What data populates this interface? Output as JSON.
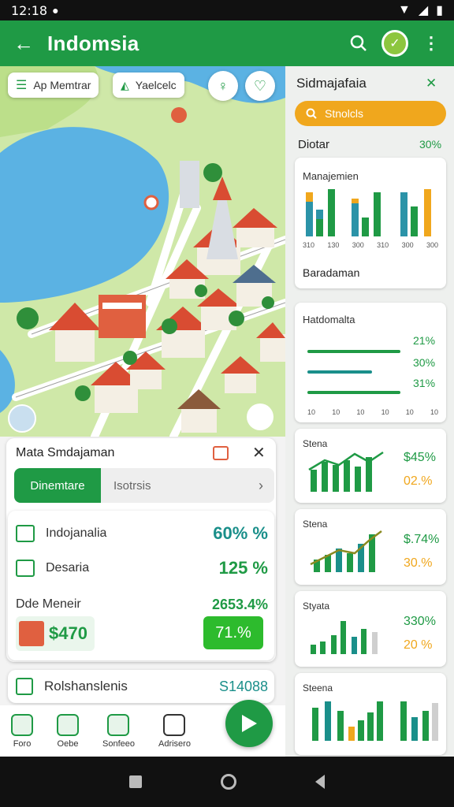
{
  "status": {
    "time": "12:18"
  },
  "appbar": {
    "title": "Indomsia",
    "back_icon": "arrow-back-icon",
    "search_icon": "search-icon",
    "avatar_icon": "profile-avatar",
    "more_icon": "more-vert-icon"
  },
  "map": {
    "chip_layers": "Ap Memtrar",
    "chip_vehicle": "Yaelcelc",
    "locate_icon": "location-icon"
  },
  "detail": {
    "title": "Mata Smdajaman",
    "tab_active": "Dinemtare",
    "tab_inactive": "Isotrsis",
    "rows": [
      {
        "label": "Indojanalia",
        "value": "60% %"
      },
      {
        "label": "Desaria",
        "value": "125 %"
      },
      {
        "label": "Dde Meneir",
        "value": "2653.4%"
      }
    ],
    "price": "$470",
    "badge": "71.%",
    "summary_label": "Rolshanslenis",
    "summary_value": "S14088"
  },
  "bottom_nav": [
    {
      "label": "Foro",
      "icon": "home-icon"
    },
    {
      "label": "Oebe",
      "icon": "bulb-icon"
    },
    {
      "label": "Sonfeeo",
      "icon": "chart-icon"
    },
    {
      "label": "Adrisero",
      "icon": "bag-icon"
    }
  ],
  "side": {
    "title": "Sidmajafaia",
    "search_label": "Stnolcls",
    "section_label": "Diotar",
    "section_value": "30%",
    "card1_title": "Manajemien",
    "card1_footer": "Baradaman",
    "card1_ticks": [
      "310",
      "130",
      "300",
      "310",
      "300",
      "300"
    ],
    "card2_title": "Hatdomalta",
    "card2_values": [
      "21%",
      "30%",
      "31%"
    ],
    "card2_ticks": [
      "10",
      "10",
      "10",
      "10",
      "10",
      "10"
    ],
    "card3": {
      "title": "Stena",
      "v1": "$45%",
      "v2": "02.%"
    },
    "card4": {
      "title": "Stena",
      "v1": "$.74%",
      "v2": "30.%"
    },
    "card5": {
      "title": "Styata",
      "v1": "330%",
      "v2": "20 %"
    },
    "card6": {
      "title": "Steena"
    }
  },
  "colors": {
    "primary": "#1f9a45",
    "accent": "#f0a71d",
    "teal": "#2b93a8"
  }
}
